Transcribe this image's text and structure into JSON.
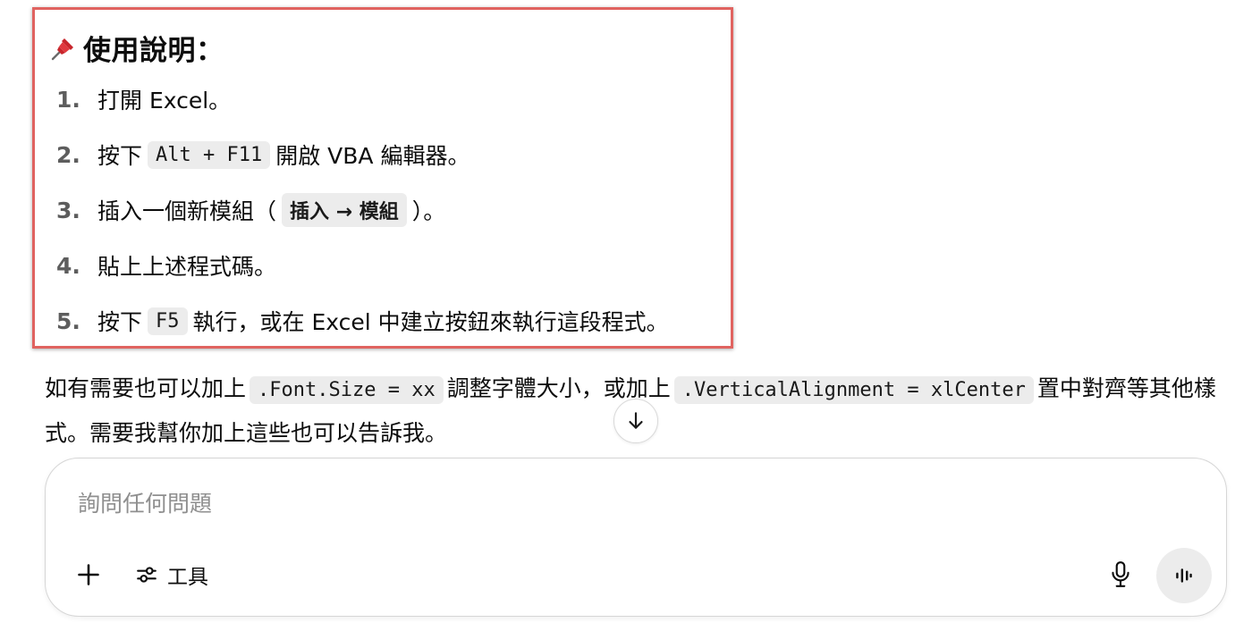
{
  "instructions": {
    "heading": "使用說明：",
    "steps": [
      {
        "num": "1.",
        "before": "打開 Excel。"
      },
      {
        "num": "2.",
        "before": "按下",
        "code": "Alt + F11",
        "after": "開啟 VBA 編輯器。"
      },
      {
        "num": "3.",
        "before": "插入一個新模組（",
        "code": "插入 → 模組",
        "after": "）。"
      },
      {
        "num": "4.",
        "before": "貼上上述程式碼。"
      },
      {
        "num": "5.",
        "before": "按下",
        "code": "F5",
        "after": "執行，或在 Excel 中建立按鈕來執行這段程式。"
      }
    ]
  },
  "paragraph": {
    "part1": "如有需要也可以加上",
    "code1": ".Font.Size = xx",
    "part2": "調整字體大小，或加上",
    "code2": ".VerticalAlignment = xlCenter",
    "part3": "置中對齊等其他樣式。需要我幫你加上這些也可以告訴我。"
  },
  "composer": {
    "placeholder": "詢問任何問題",
    "tools_label": "工具"
  },
  "icons": {
    "pin": "pushpin-icon",
    "scroll": "arrow-down-icon",
    "plus": "plus-icon",
    "tools": "sliders-icon",
    "mic": "microphone-icon",
    "voice": "voice-waveform-icon"
  },
  "colors": {
    "highlight_border": "#e06360",
    "code_background": "#ececec",
    "step_number": "#5d5d5d",
    "placeholder": "#8f8f8f"
  }
}
